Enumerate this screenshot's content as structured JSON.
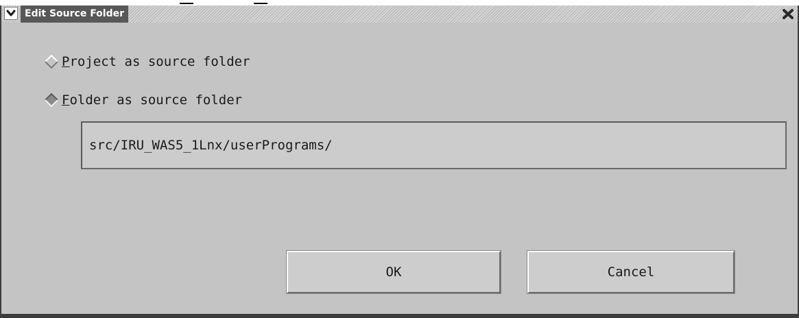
{
  "window": {
    "title": "Edit Source Folder"
  },
  "options": [
    {
      "mnemonic": "P",
      "rest": "roject as source folder",
      "selected": false
    },
    {
      "mnemonic": "F",
      "rest": "older as source folder",
      "selected": true
    }
  ],
  "folder_path": {
    "value": "src/IRU_WAS5_1Lnx/userPrograms/"
  },
  "buttons": {
    "ok": "OK",
    "cancel": "Cancel"
  },
  "colors": {
    "window_bg": "#c4c4c4",
    "title_label_bg": "#585858",
    "frame": "#3c3c3c"
  },
  "icons": {
    "title_menu": "chevron-down-icon",
    "title_close": "close-icon"
  }
}
